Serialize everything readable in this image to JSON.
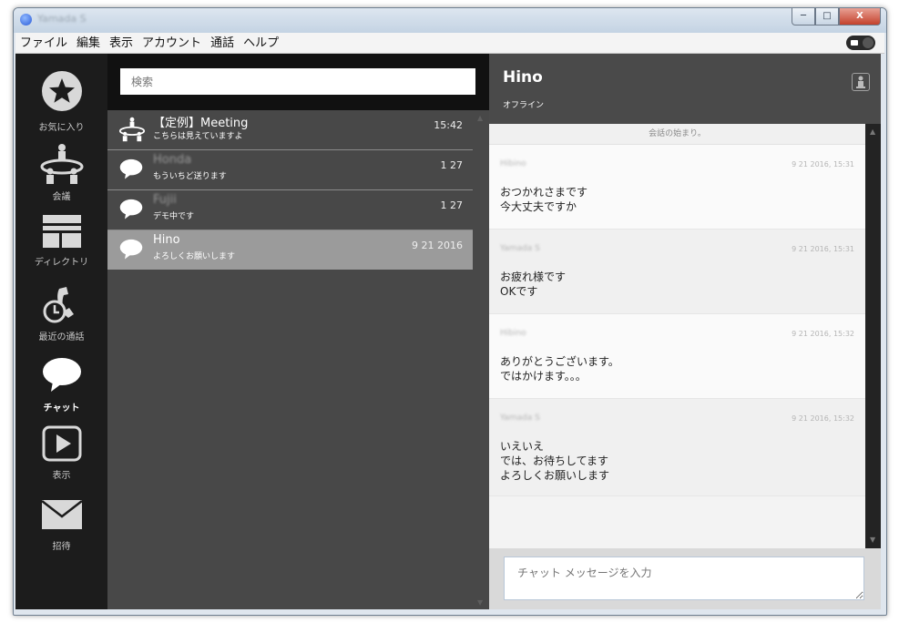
{
  "window": {
    "title": "Yamada S"
  },
  "menu": {
    "items": [
      "ファイル",
      "編集",
      "表示",
      "アカウント",
      "通話",
      "ヘルプ"
    ]
  },
  "sidebar": {
    "items": [
      {
        "label": "お気に入り",
        "icon": "star-icon"
      },
      {
        "label": "会議",
        "icon": "meeting-icon"
      },
      {
        "label": "ディレクトリ",
        "icon": "directory-icon"
      },
      {
        "label": "最近の通話",
        "icon": "recent-calls-icon"
      },
      {
        "label": "チャット",
        "icon": "chat-icon",
        "active": true
      },
      {
        "label": "表示",
        "icon": "play-icon"
      },
      {
        "label": "招待",
        "icon": "envelope-icon"
      }
    ]
  },
  "search": {
    "placeholder": "検索"
  },
  "conversations": [
    {
      "name": "【定例】Meeting",
      "preview": "こちらは見えていますよ",
      "time": "15:42",
      "type": "meeting"
    },
    {
      "name": "Honda",
      "preview": "もういちど送ります",
      "time": "1 27",
      "type": "chat"
    },
    {
      "name": "Fujii",
      "preview": "デモ中です",
      "time": "1 27",
      "type": "chat"
    },
    {
      "name": "Hino",
      "preview": "よろしくお願いします",
      "time": "9 21 2016",
      "type": "chat",
      "selected": true
    }
  ],
  "chat": {
    "contact_name": "Hino",
    "status": "オフライン",
    "start_notice": "会話の始まり。",
    "messages": [
      {
        "sender": "Hibino",
        "timestamp": "9 21 2016, 15:31",
        "text": "おつかれさまです\n今大丈夫ですか"
      },
      {
        "sender": "Yamada S",
        "timestamp": "9 21 2016, 15:31",
        "text": "お疲れ様です\nOKです"
      },
      {
        "sender": "Hibino",
        "timestamp": "9 21 2016, 15:32",
        "text": "ありがとうございます。\nではかけます。。。"
      },
      {
        "sender": "Yamada S",
        "timestamp": "9 21 2016, 15:32",
        "text": "いえいえ\nでは、お待ちしてます\nよろしくお願いします"
      }
    ],
    "input_placeholder": "チャット メッセージを入力"
  }
}
